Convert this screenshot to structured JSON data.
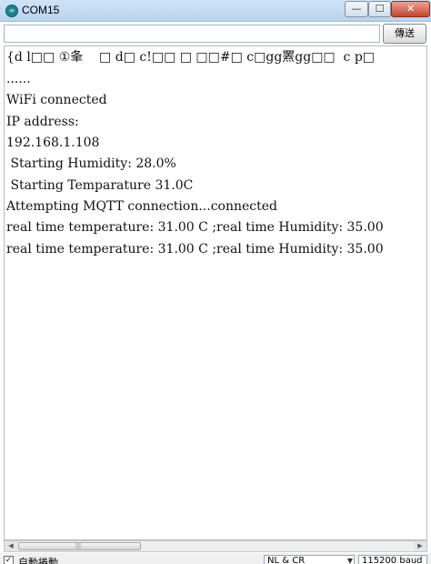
{
  "window": {
    "title": "COM15",
    "icon": "arduino-icon",
    "icon_glyph": "∞",
    "minimize_glyph": "—",
    "maximize_glyph": "☐",
    "close_glyph": "✕"
  },
  "send_bar": {
    "input_value": "",
    "send_label": "傳送"
  },
  "output": {
    "lines": [
      "{d l□□ ①夆    □ d□ c!□□ □ □□#□ c□gg罴gg□□  c p□",
      "......",
      "WiFi connected",
      "IP address:",
      "192.168.1.108",
      " Starting Humidity: 28.0%",
      " Starting Temparature 31.0C",
      "Attempting MQTT connection...connected",
      "real time temperature: 31.00 C ;real time Humidity: 35.00",
      "real time temperature: 31.00 C ;real time Humidity: 35.00"
    ]
  },
  "scrollbar": {
    "left_arrow": "◀",
    "right_arrow": "▶",
    "grip": "|||"
  },
  "footer": {
    "autoscroll_label": "自動捲動",
    "autoscroll_checked": "✓",
    "line_ending": "NL & CR",
    "baud_rate": "115200 baud",
    "dropdown_glyph": "▼"
  }
}
